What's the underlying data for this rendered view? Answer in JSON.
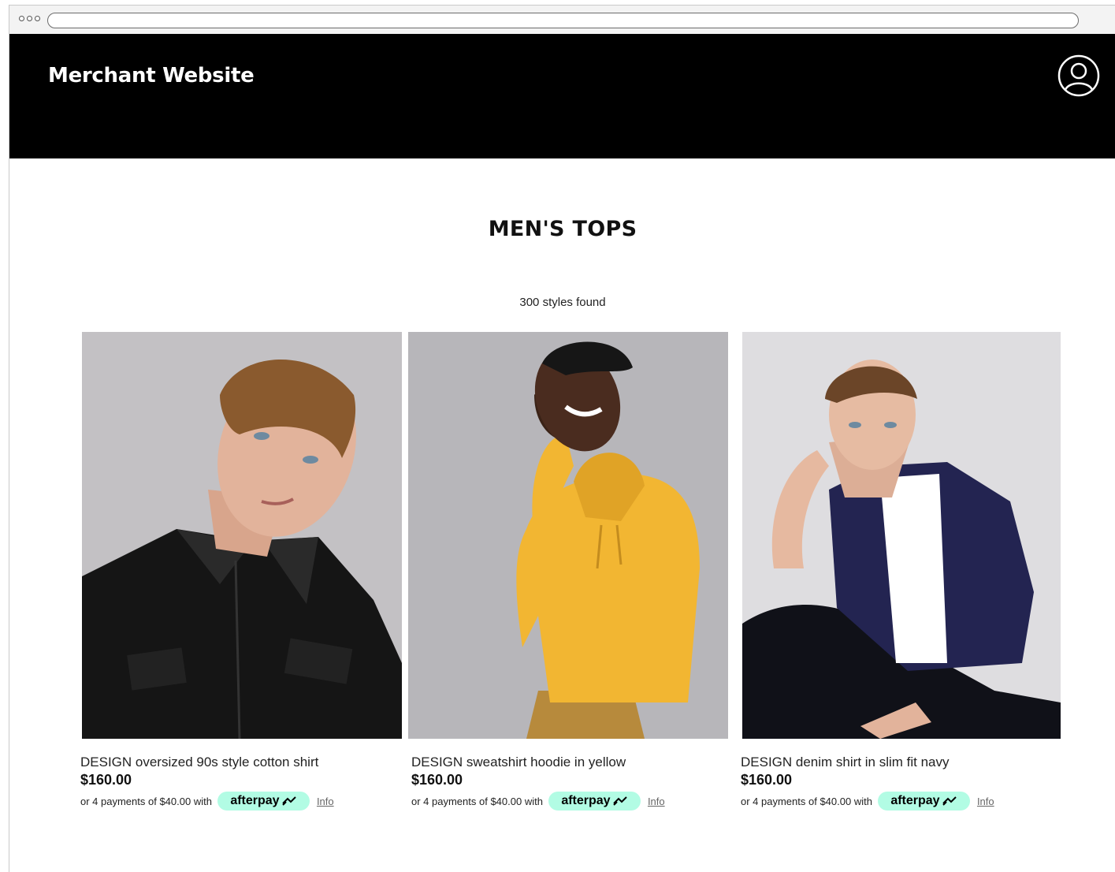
{
  "header": {
    "brand": "Merchant Website",
    "account_icon": "user-account-icon"
  },
  "listing": {
    "title": "MEN'S TOPS",
    "count": "300 styles found"
  },
  "products": [
    {
      "name": "DESIGN oversized 90s style cotton shirt",
      "price": "$160.00",
      "installments": "or 4 payments of $40.00 with",
      "provider": "afterpay",
      "info": "Info"
    },
    {
      "name": "DESIGN sweatshirt hoodie in yellow",
      "price": "$160.00",
      "installments": "or 4 payments of $40.00 with",
      "provider": "afterpay",
      "info": "Info"
    },
    {
      "name": "DESIGN denim shirt in slim fit navy",
      "price": "$160.00",
      "installments": "or 4 payments of $40.00 with",
      "provider": "afterpay",
      "info": "Info"
    }
  ],
  "colors": {
    "header_bg": "#000000",
    "afterpay_mint": "#b2fce4",
    "yellow_hoodie": "#f2b632",
    "navy_shirt": "#232451"
  }
}
